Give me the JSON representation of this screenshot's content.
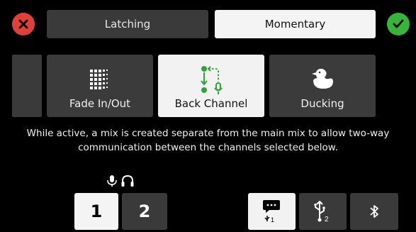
{
  "header": {
    "cancel_icon": "close-icon",
    "confirm_icon": "check-icon",
    "modes": [
      {
        "label": "Latching",
        "selected": false
      },
      {
        "label": "Momentary",
        "selected": true
      }
    ]
  },
  "functions": [
    {
      "label": "Fade In/Out",
      "icon": "grid-icon",
      "selected": false
    },
    {
      "label": "Back Channel",
      "icon": "back-channel-icon",
      "selected": true
    },
    {
      "label": "Ducking",
      "icon": "duck-icon",
      "selected": false
    }
  ],
  "description": "While active, a mix is created separate from the main mix to allow two-way communication between the channels selected below.",
  "channels": {
    "header_icons": [
      "microphone-icon",
      "headphones-icon"
    ],
    "items": [
      {
        "label": "1",
        "selected": true
      },
      {
        "label": "2",
        "selected": false
      }
    ]
  },
  "inputs": [
    {
      "icon": "chat-usb-icon",
      "sub": "1"
    },
    {
      "icon": "usb-icon",
      "sub": "2"
    },
    {
      "icon": "bluetooth-icon"
    }
  ],
  "colors": {
    "cancel": "#e0403a",
    "confirm": "#35b53a",
    "tile": "#3b3b3b",
    "selected": "#f3f3f3",
    "accent_green": "#2fa43a"
  }
}
